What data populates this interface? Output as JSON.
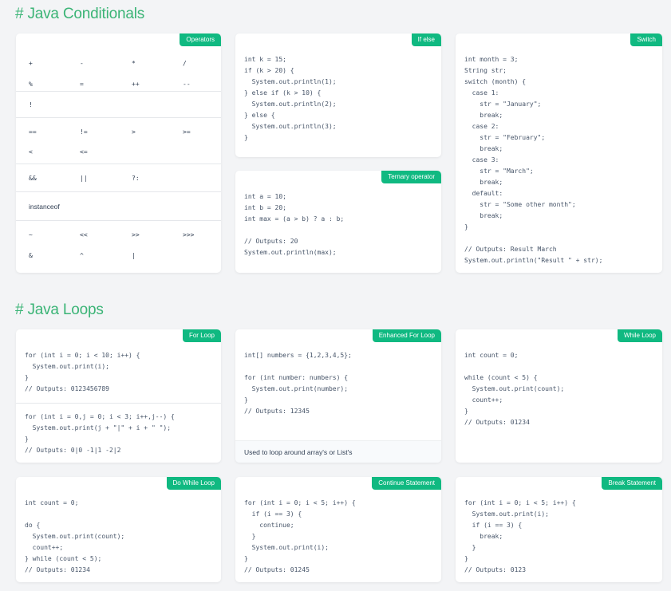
{
  "sections": {
    "conditionals_title": "# Java Conditionals",
    "loops_title": "# Java Loops"
  },
  "colors": {
    "accent": "#10b981",
    "heading": "#3bb476",
    "code_keyword": "#b45309"
  },
  "operators": {
    "badge": "Operators",
    "groups": [
      [
        [
          "+",
          "-",
          "*",
          "/"
        ],
        [
          "%",
          "=",
          "++",
          "--"
        ],
        [
          "!"
        ]
      ],
      [
        [
          "==",
          "!=",
          ">",
          ">="
        ],
        [
          "<",
          "<="
        ]
      ],
      [
        [
          "&&",
          "||",
          "?:"
        ]
      ],
      [
        [
          "instanceof"
        ]
      ],
      [
        [
          "~",
          "<<",
          ">>",
          ">>>"
        ],
        [
          "&",
          "^",
          "|"
        ]
      ]
    ]
  },
  "cards": {
    "if_else": {
      "badge": "If else",
      "code": "int k = 15;\nif (k > 20) {\n  System.out.println(1);\n} else if (k > 10) {\n  System.out.println(2);\n} else {\n  System.out.println(3);\n}"
    },
    "ternary": {
      "badge": "Ternary operator",
      "code": "int a = 10;\nint b = 20;\nint max = (a > b) ? a : b;\n\n// Outputs: 20\nSystem.out.println(max);"
    },
    "switch": {
      "badge": "Switch",
      "code": "int month = 3;\nString str;\nswitch (month) {\n  case 1:\n    str = \"January\";\n    break;\n  case 2:\n    str = \"February\";\n    break;\n  case 3:\n    str = \"March\";\n    break;\n  default:\n    str = \"Some other month\";\n    break;\n}\n\n// Outputs: Result March\nSystem.out.println(\"Result \" + str);"
    },
    "for_loop": {
      "badge": "For Loop",
      "code1": "for (int i = 0; i < 10; i++) {\n  System.out.print(i);\n}\n// Outputs: 0123456789",
      "code2": "for (int i = 0,j = 0; i < 3; i++,j--) {\n  System.out.print(j + \"|\" + i + \" \");\n}\n// Outputs: 0|0 -1|1 -2|2"
    },
    "enhanced_for": {
      "badge": "Enhanced For Loop",
      "code": "int[] numbers = {1,2,3,4,5};\n\nfor (int number: numbers) {\n  System.out.print(number);\n}\n// Outputs: 12345",
      "note": "Used to loop around array's or List's"
    },
    "while_loop": {
      "badge": "While Loop",
      "code": "int count = 0;\n\nwhile (count < 5) {\n  System.out.print(count);\n  count++;\n}\n// Outputs: 01234"
    },
    "do_while": {
      "badge": "Do While Loop",
      "code": "int count = 0;\n\ndo {\n  System.out.print(count);\n  count++;\n} while (count < 5);\n// Outputs: 01234"
    },
    "continue": {
      "badge": "Continue Statement",
      "code": "for (int i = 0; i < 5; i++) {\n  if (i == 3) {\n    continue;\n  }\n  System.out.print(i);\n}\n// Outputs: 01245"
    },
    "break": {
      "badge": "Break Statement",
      "code": "for (int i = 0; i < 5; i++) {\n  System.out.print(i);\n  if (i == 3) {\n    break;\n  }\n}\n// Outputs: 0123"
    }
  }
}
